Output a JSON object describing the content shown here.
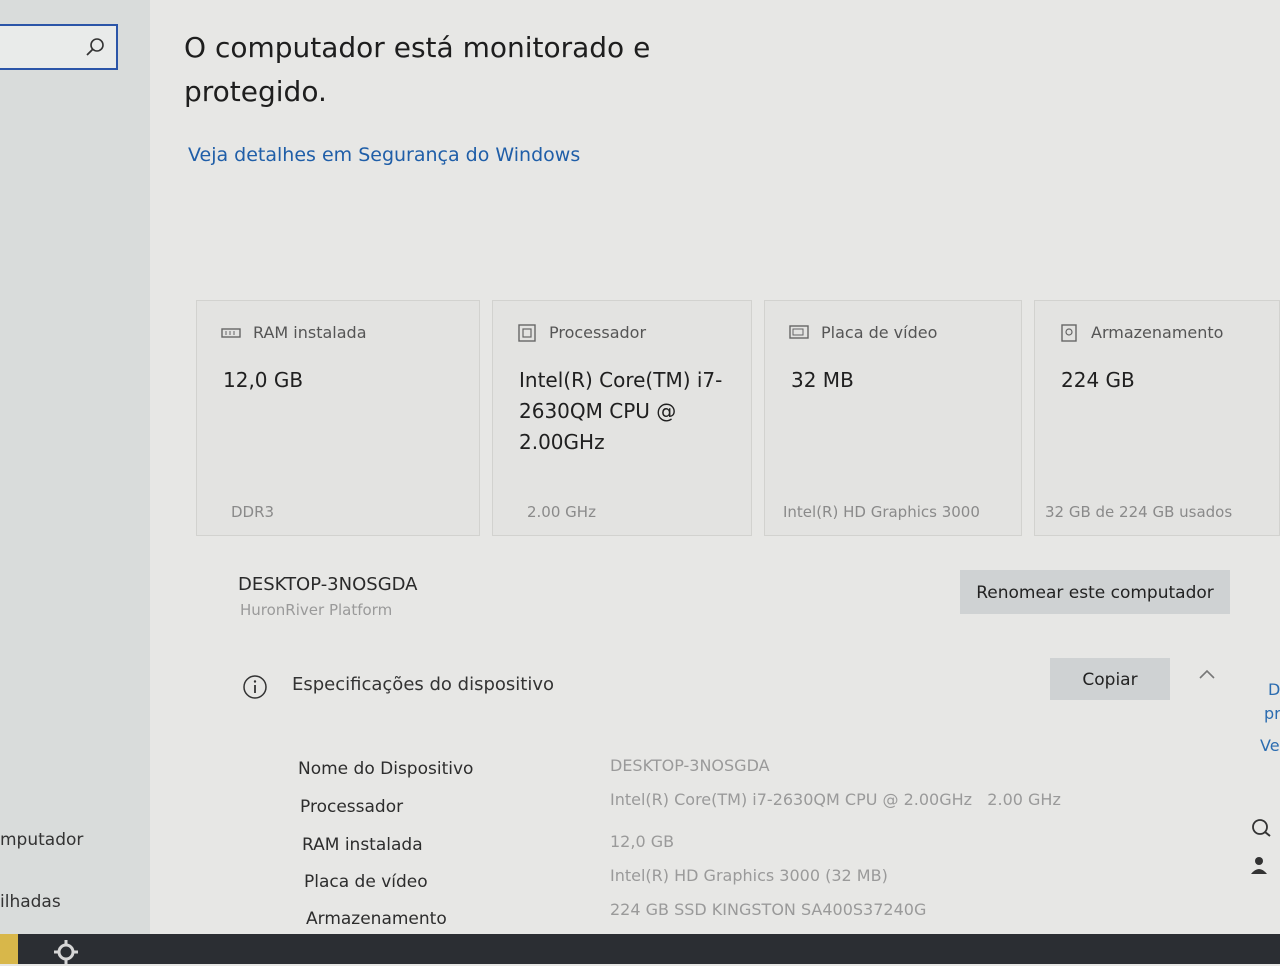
{
  "sidebar": {
    "search_placeholder": "",
    "items": [
      {
        "label": "mputador"
      },
      {
        "label": "ilhadas"
      }
    ]
  },
  "header": {
    "title": "O computador está monitorado e protegido.",
    "details_link": "Veja detalhes em Segurança do Windows"
  },
  "cards": [
    {
      "icon": "ram-icon",
      "title": "RAM instalada",
      "value": "12,0 GB",
      "footer": "DDR3"
    },
    {
      "icon": "processor-icon",
      "title": "Processador",
      "value": "Intel(R) Core(TM) i7-2630QM CPU @ 2.00GHz",
      "footer": "2.00 GHz"
    },
    {
      "icon": "display-icon",
      "title": "Placa de vídeo",
      "value": "32 MB",
      "footer": "Intel(R) HD Graphics 3000"
    },
    {
      "icon": "storage-icon",
      "title": "Armazenamento",
      "value": "224 GB",
      "footer": "32 GB de 224 GB usados"
    }
  ],
  "device": {
    "name": "DESKTOP-3NOSGDA",
    "platform": "HuronRiver Platform",
    "rename_label": "Renomear este computador"
  },
  "specs": {
    "title": "Especificações do dispositivo",
    "copy_label": "Copiar",
    "rows": [
      {
        "label": "Nome do Dispositivo",
        "value": "DESKTOP-3NOSGDA"
      },
      {
        "label": "Processador",
        "value": "Intel(R) Core(TM) i7-2630QM CPU @ 2.00GHz   2.00 GHz"
      },
      {
        "label": "RAM instalada",
        "value": "12,0 GB"
      },
      {
        "label": "Placa de vídeo",
        "value": "Intel(R) HD Graphics 3000 (32 MB)"
      },
      {
        "label": "Armazenamento",
        "value": "224 GB SSD KINGSTON SA400S37240G"
      }
    ]
  },
  "right_edge": {
    "fragments": [
      "D",
      "pr",
      "Ve"
    ]
  },
  "colors": {
    "link": "#1f5ea8",
    "accent_border": "#2b55a8",
    "taskbar": "#2b2e33"
  }
}
